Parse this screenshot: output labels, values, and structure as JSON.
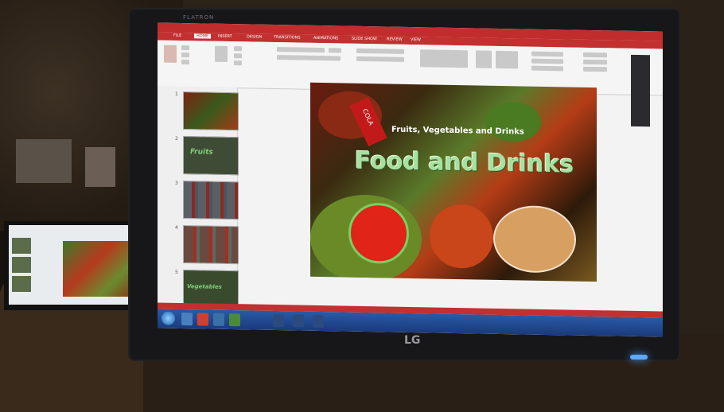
{
  "photo": {
    "monitor_brand_top": "FLATRON",
    "monitor_logo": "LG"
  },
  "powerpoint": {
    "tabs": [
      "FILE",
      "HOME",
      "INSERT",
      "DESIGN",
      "TRANSITIONS",
      "ANIMATIONS",
      "SLIDE SHOW",
      "REVIEW",
      "VIEW"
    ],
    "active_tab": "HOME",
    "slides": [
      {
        "num": "1",
        "text": ""
      },
      {
        "num": "2",
        "text": "Fruits"
      },
      {
        "num": "3",
        "text": ""
      },
      {
        "num": "4",
        "text": ""
      },
      {
        "num": "5",
        "text": "Vegetables"
      }
    ],
    "current_slide": {
      "subtitle": "Fruits, Vegetables and Drinks",
      "title": "Food and Drinks",
      "can_label": "COLA"
    }
  },
  "colors": {
    "accent": "#c23030",
    "title_green": "#a8e0a0",
    "taskbar": "#1e4a94"
  }
}
